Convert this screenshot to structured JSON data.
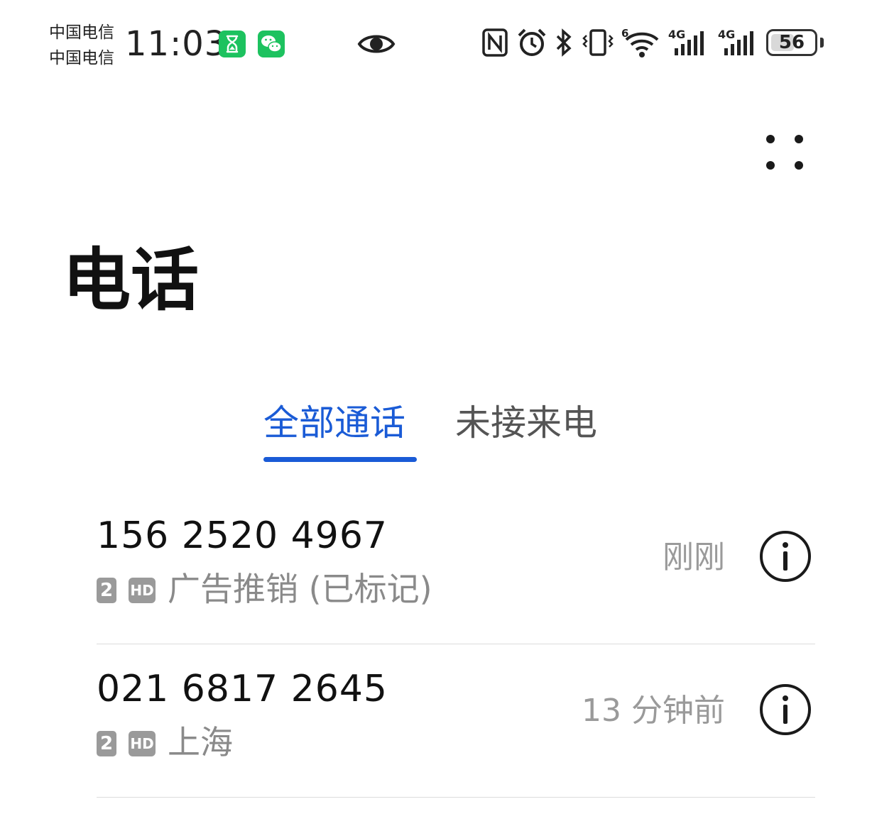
{
  "status_bar": {
    "carrier_1": "中国电信",
    "carrier_2": "中国电信",
    "time": "11:03",
    "battery_level": "56",
    "signal_1_label": "4G",
    "signal_2_label": "4G",
    "wifi_label": "6",
    "icons": [
      "hourglass-app-icon",
      "wechat-icon",
      "eye-icon",
      "nfc-icon",
      "alarm-icon",
      "bluetooth-icon",
      "vibrate-icon",
      "wifi-6-icon",
      "signal-4g-icon",
      "signal-4g-icon",
      "battery-icon"
    ]
  },
  "header": {
    "more_icon": "more-dots-icon"
  },
  "page": {
    "title": "电话"
  },
  "tabs": [
    {
      "label": "全部通话",
      "active": true
    },
    {
      "label": "未接来电",
      "active": false
    }
  ],
  "colors": {
    "accent": "#1a5bd6",
    "wechat_green": "#1dc25f",
    "muted_text": "#8a8a8a"
  },
  "calls": [
    {
      "number": "156 2520 4967",
      "sim": "2",
      "hd": "HD",
      "label": "广告推销 (已标记)",
      "time": "刚刚"
    },
    {
      "number": "021 6817 2645",
      "sim": "2",
      "hd": "HD",
      "label": "上海",
      "time": "13 分钟前"
    }
  ]
}
